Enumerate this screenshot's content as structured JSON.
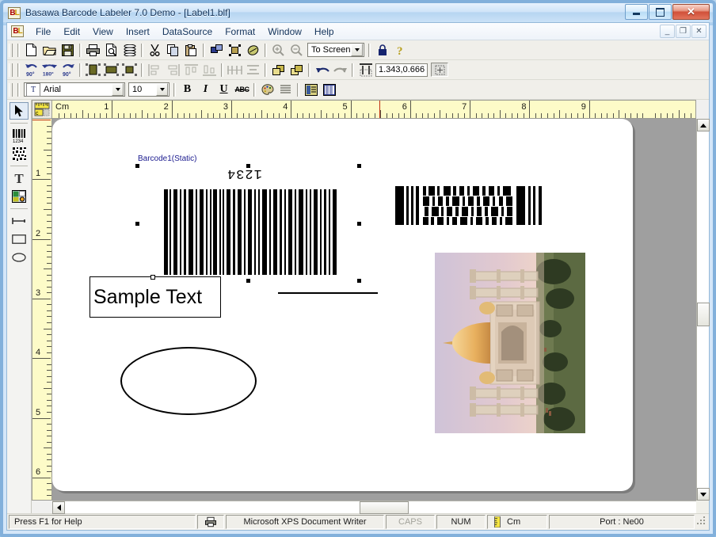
{
  "window": {
    "title": "Basawa Barcode Labeler 7.0  Demo   - [Label1.blf]",
    "logo_left": "B",
    "logo_right": "L",
    "controls": {
      "minimize": "minimize-button",
      "restore": "restore-button",
      "close": "✕"
    },
    "mdi_controls": {
      "minimize": "_",
      "restore": "❐",
      "close": "✕"
    }
  },
  "menu": {
    "items": [
      {
        "label": "File"
      },
      {
        "label": "Edit"
      },
      {
        "label": "View"
      },
      {
        "label": "Insert"
      },
      {
        "label": "DataSource"
      },
      {
        "label": "Format"
      },
      {
        "label": "Window"
      },
      {
        "label": "Help"
      }
    ]
  },
  "toolbar_standard": {
    "buttons": [
      {
        "name": "new-icon",
        "tip": "New"
      },
      {
        "name": "open-icon",
        "tip": "Open"
      },
      {
        "name": "save-icon",
        "tip": "Save"
      },
      {
        "name": "print-icon",
        "tip": "Print"
      },
      {
        "name": "print-preview-icon",
        "tip": "Print Preview"
      },
      {
        "name": "database-icon",
        "tip": "Data Source"
      },
      {
        "name": "cut-icon",
        "tip": "Cut"
      },
      {
        "name": "copy-icon",
        "tip": "Copy"
      },
      {
        "name": "paste-icon",
        "tip": "Paste"
      },
      {
        "name": "duplicate-icon",
        "tip": "Duplicate"
      },
      {
        "name": "group-icon",
        "tip": "Group"
      },
      {
        "name": "eraser-icon",
        "tip": "Erase"
      },
      {
        "name": "zoom-in-icon",
        "tip": "Zoom In"
      },
      {
        "name": "zoom-out-icon",
        "tip": "Zoom Out"
      }
    ],
    "zoom_value": "To Screen",
    "lock_icon": "lock-icon",
    "help_icon": "help-icon"
  },
  "toolbar_arrange": {
    "rotate_ccw_90": "90°",
    "rotate_180": "180°",
    "rotate_cw_90": "90°",
    "coordinates": "1.343,0.666"
  },
  "toolbar_format": {
    "font_name": "Arial",
    "font_size": "10",
    "bold": "B",
    "italic": "I",
    "underline": "U",
    "strikethrough": "ABC",
    "color_icon": "palette-icon",
    "align_icon": "align-icon",
    "properties_icon": "properties-icon",
    "barcode_props_icon": "barcode-properties-icon"
  },
  "left_toolbox": {
    "items": [
      {
        "name": "select-tool",
        "label": "Select"
      },
      {
        "name": "barcode-1d-tool",
        "label": "Barcode"
      },
      {
        "name": "barcode-2d-tool",
        "label": "2D Barcode"
      },
      {
        "name": "text-tool",
        "label": "T"
      },
      {
        "name": "image-tool",
        "label": "Image"
      },
      {
        "name": "line-tool",
        "label": "Line"
      },
      {
        "name": "rectangle-tool",
        "label": "Rectangle"
      },
      {
        "name": "ellipse-tool",
        "label": "Ellipse"
      }
    ],
    "selected": "select-tool"
  },
  "rulers": {
    "unit": "Cm",
    "horizontal_labels": [
      "1",
      "2",
      "3",
      "4",
      "5",
      "6",
      "7",
      "8",
      "9"
    ],
    "vertical_labels": [
      "1",
      "2",
      "3",
      "4",
      "5",
      "6"
    ]
  },
  "canvas": {
    "objects": [
      {
        "type": "barcode",
        "name": "Barcode1(Static)",
        "label": "Barcode1(Static)",
        "human_readable": "1234",
        "selected": true,
        "rotation": 180
      },
      {
        "type": "barcode2d",
        "name": "Barcode2",
        "selected": false
      },
      {
        "type": "text",
        "name": "Text1",
        "value": "Sample Text"
      },
      {
        "type": "line",
        "name": "Line1"
      },
      {
        "type": "ellipse",
        "name": "Ellipse1"
      },
      {
        "type": "image",
        "name": "Picture1",
        "rotation": 90
      }
    ]
  },
  "statusbar": {
    "hint": "Press F1 for Help",
    "printer_icon": "printer-icon",
    "printer": "Microsoft XPS Document Writer",
    "caps": "CAPS",
    "num": "NUM",
    "unit_icon": "ruler-icon",
    "unit": "Cm",
    "port": "Port : Ne00"
  },
  "colors": {
    "ruler_bg": "#fdfbc8",
    "page_bg": "#ffffff",
    "desk_bg": "#9f9f9f",
    "label_text": "#1b1b8f",
    "title_text": "#12335a"
  }
}
